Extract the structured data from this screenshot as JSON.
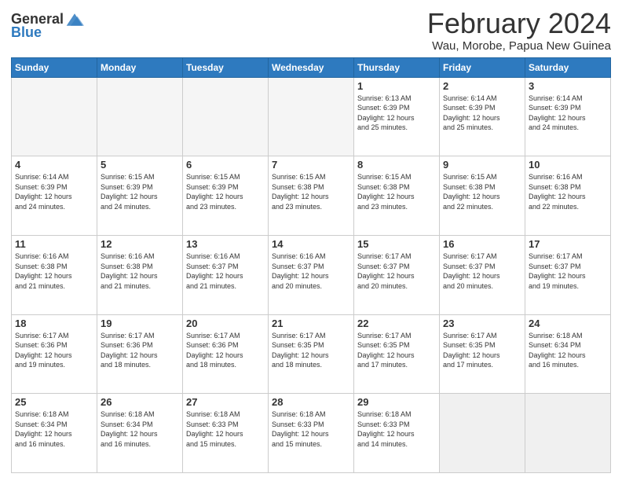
{
  "header": {
    "logo": {
      "general": "General",
      "blue": "Blue"
    },
    "title": "February 2024",
    "subtitle": "Wau, Morobe, Papua New Guinea"
  },
  "weekdays": [
    "Sunday",
    "Monday",
    "Tuesday",
    "Wednesday",
    "Thursday",
    "Friday",
    "Saturday"
  ],
  "weeks": [
    [
      {
        "day": "",
        "info": "",
        "empty": true
      },
      {
        "day": "",
        "info": "",
        "empty": true
      },
      {
        "day": "",
        "info": "",
        "empty": true
      },
      {
        "day": "",
        "info": "",
        "empty": true
      },
      {
        "day": "1",
        "info": "Sunrise: 6:13 AM\nSunset: 6:39 PM\nDaylight: 12 hours\nand 25 minutes."
      },
      {
        "day": "2",
        "info": "Sunrise: 6:14 AM\nSunset: 6:39 PM\nDaylight: 12 hours\nand 25 minutes."
      },
      {
        "day": "3",
        "info": "Sunrise: 6:14 AM\nSunset: 6:39 PM\nDaylight: 12 hours\nand 24 minutes."
      }
    ],
    [
      {
        "day": "4",
        "info": "Sunrise: 6:14 AM\nSunset: 6:39 PM\nDaylight: 12 hours\nand 24 minutes."
      },
      {
        "day": "5",
        "info": "Sunrise: 6:15 AM\nSunset: 6:39 PM\nDaylight: 12 hours\nand 24 minutes."
      },
      {
        "day": "6",
        "info": "Sunrise: 6:15 AM\nSunset: 6:39 PM\nDaylight: 12 hours\nand 23 minutes."
      },
      {
        "day": "7",
        "info": "Sunrise: 6:15 AM\nSunset: 6:38 PM\nDaylight: 12 hours\nand 23 minutes."
      },
      {
        "day": "8",
        "info": "Sunrise: 6:15 AM\nSunset: 6:38 PM\nDaylight: 12 hours\nand 23 minutes."
      },
      {
        "day": "9",
        "info": "Sunrise: 6:15 AM\nSunset: 6:38 PM\nDaylight: 12 hours\nand 22 minutes."
      },
      {
        "day": "10",
        "info": "Sunrise: 6:16 AM\nSunset: 6:38 PM\nDaylight: 12 hours\nand 22 minutes."
      }
    ],
    [
      {
        "day": "11",
        "info": "Sunrise: 6:16 AM\nSunset: 6:38 PM\nDaylight: 12 hours\nand 21 minutes."
      },
      {
        "day": "12",
        "info": "Sunrise: 6:16 AM\nSunset: 6:38 PM\nDaylight: 12 hours\nand 21 minutes."
      },
      {
        "day": "13",
        "info": "Sunrise: 6:16 AM\nSunset: 6:37 PM\nDaylight: 12 hours\nand 21 minutes."
      },
      {
        "day": "14",
        "info": "Sunrise: 6:16 AM\nSunset: 6:37 PM\nDaylight: 12 hours\nand 20 minutes."
      },
      {
        "day": "15",
        "info": "Sunrise: 6:17 AM\nSunset: 6:37 PM\nDaylight: 12 hours\nand 20 minutes."
      },
      {
        "day": "16",
        "info": "Sunrise: 6:17 AM\nSunset: 6:37 PM\nDaylight: 12 hours\nand 20 minutes."
      },
      {
        "day": "17",
        "info": "Sunrise: 6:17 AM\nSunset: 6:37 PM\nDaylight: 12 hours\nand 19 minutes."
      }
    ],
    [
      {
        "day": "18",
        "info": "Sunrise: 6:17 AM\nSunset: 6:36 PM\nDaylight: 12 hours\nand 19 minutes."
      },
      {
        "day": "19",
        "info": "Sunrise: 6:17 AM\nSunset: 6:36 PM\nDaylight: 12 hours\nand 18 minutes."
      },
      {
        "day": "20",
        "info": "Sunrise: 6:17 AM\nSunset: 6:36 PM\nDaylight: 12 hours\nand 18 minutes."
      },
      {
        "day": "21",
        "info": "Sunrise: 6:17 AM\nSunset: 6:35 PM\nDaylight: 12 hours\nand 18 minutes."
      },
      {
        "day": "22",
        "info": "Sunrise: 6:17 AM\nSunset: 6:35 PM\nDaylight: 12 hours\nand 17 minutes."
      },
      {
        "day": "23",
        "info": "Sunrise: 6:17 AM\nSunset: 6:35 PM\nDaylight: 12 hours\nand 17 minutes."
      },
      {
        "day": "24",
        "info": "Sunrise: 6:18 AM\nSunset: 6:34 PM\nDaylight: 12 hours\nand 16 minutes."
      }
    ],
    [
      {
        "day": "25",
        "info": "Sunrise: 6:18 AM\nSunset: 6:34 PM\nDaylight: 12 hours\nand 16 minutes."
      },
      {
        "day": "26",
        "info": "Sunrise: 6:18 AM\nSunset: 6:34 PM\nDaylight: 12 hours\nand 16 minutes."
      },
      {
        "day": "27",
        "info": "Sunrise: 6:18 AM\nSunset: 6:33 PM\nDaylight: 12 hours\nand 15 minutes."
      },
      {
        "day": "28",
        "info": "Sunrise: 6:18 AM\nSunset: 6:33 PM\nDaylight: 12 hours\nand 15 minutes."
      },
      {
        "day": "29",
        "info": "Sunrise: 6:18 AM\nSunset: 6:33 PM\nDaylight: 12 hours\nand 14 minutes."
      },
      {
        "day": "",
        "info": "",
        "empty": true
      },
      {
        "day": "",
        "info": "",
        "empty": true
      }
    ]
  ]
}
